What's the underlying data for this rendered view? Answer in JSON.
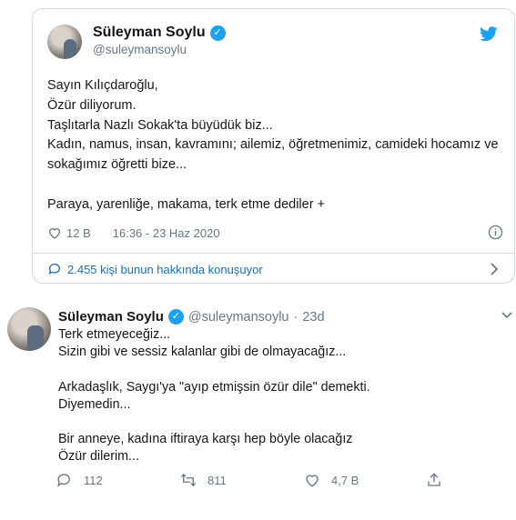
{
  "embedded": {
    "name": "Süleyman Soylu",
    "handle": "@suleymansoylu",
    "text": "Sayın Kılıçdaroğlu,\nÖzür diliyorum.\nTaşlıtarla Nazlı Sokak'ta büyüdük biz...\nKadın, namus, insan, kavramını; ailemiz, öğretmenimiz, camideki hocamız ve sokağımız öğretti bize...\n\nParaya, yarenliğe, makama, terk etme dediler +",
    "likes": "12 B",
    "time": "16:36 - 23 Haz 2020",
    "discussion": "2.455 kişi bunun hakkında konuşuyor",
    "icons": [
      "verified-badge",
      "twitter-bird",
      "heart",
      "info",
      "speech-bubble",
      "chevron-right"
    ]
  },
  "tweet": {
    "name": "Süleyman Soylu",
    "handle": "@suleymansoylu",
    "dot": "·",
    "age": "23d",
    "text": "Terk etmeyeceğiz...\nSizin gibi ve sessiz kalanlar gibi de olmayacağız...\n\nArkadaşlık, Saygı'ya \"ayıp etmişsin özür dile\" demekti.\nDiyemedin...\n\nBir anneye, kadına iftiraya karşı hep böyle olacağız\nÖzür dilerim...",
    "replies": "112",
    "retweets": "811",
    "likes": "4,7 B"
  },
  "colors": {
    "accent": "#1da1f2",
    "link": "#1b6fb5",
    "muted": "#657786",
    "text": "#14171a"
  }
}
